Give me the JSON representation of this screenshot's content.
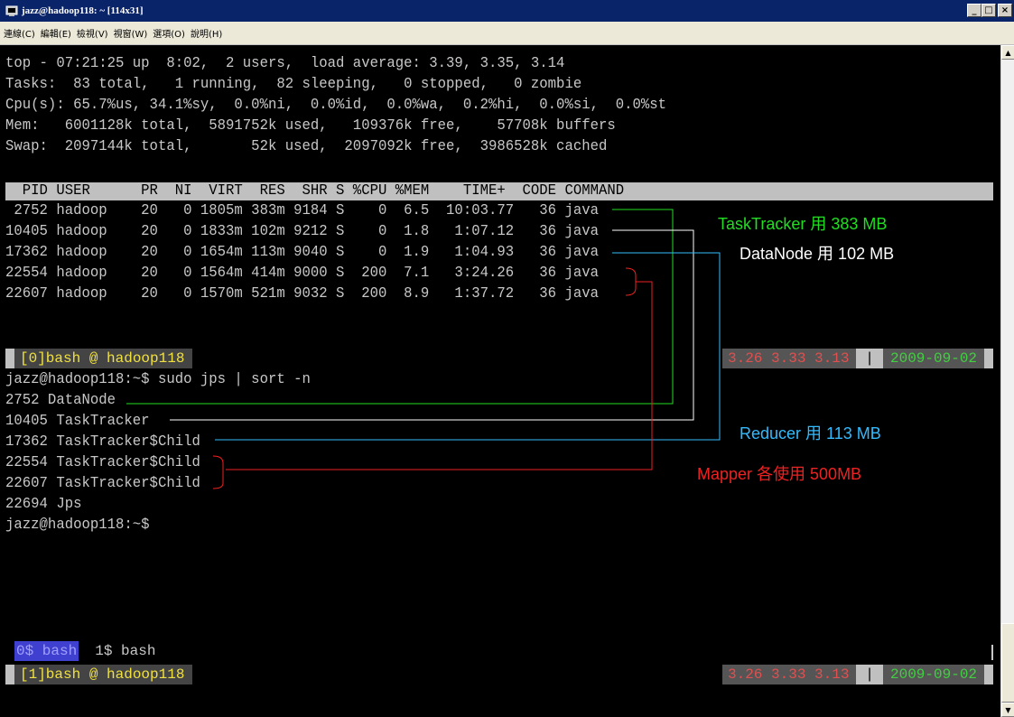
{
  "window": {
    "title": "jazz@hadoop118: ~ [114x31]",
    "buttons": {
      "minimize": "_",
      "maximize": "□",
      "close": "×"
    }
  },
  "menu": [
    "連線(C)",
    "編輯(E)",
    "檢視(V)",
    "視窗(W)",
    "選項(O)",
    "說明(H)"
  ],
  "top": {
    "summary": [
      "top - 07:21:25 up  8:02,  2 users,  load average: 3.39, 3.35, 3.14",
      "Tasks:  83 total,   1 running,  82 sleeping,   0 stopped,   0 zombie",
      "Cpu(s): 65.7%us, 34.1%sy,  0.0%ni,  0.0%id,  0.0%wa,  0.2%hi,  0.0%si,  0.0%st",
      "Mem:   6001128k total,  5891752k used,   109376k free,    57708k buffers",
      "Swap:  2097144k total,       52k used,  2097092k free,  3986528k cached"
    ],
    "header": "  PID USER      PR  NI  VIRT  RES  SHR S %CPU %MEM    TIME+  CODE COMMAND",
    "processes": [
      " 2752 hadoop    20   0 1805m 383m 9184 S    0  6.5  10:03.77   36 java",
      "10405 hadoop    20   0 1833m 102m 9212 S    0  1.8   1:07.12   36 java",
      "17362 hadoop    20   0 1654m 113m 9040 S    0  1.9   1:04.93   36 java",
      "22554 hadoop    20   0 1564m 414m 9000 S  200  7.1   3:24.26   36 java",
      "22607 hadoop    20   0 1570m 521m 9032 S  200  8.9   1:37.72   36 java"
    ]
  },
  "status_bar_0": {
    "window": "[0]bash @ hadoop118",
    "load": "3.26 3.33 3.13",
    "sep": "|",
    "date": "2009-09-02"
  },
  "shell": [
    "jazz@hadoop118:~$ sudo jps | sort -n",
    "2752 DataNode",
    "10405 TaskTracker",
    "17362 TaskTracker$Child",
    "22554 TaskTracker$Child",
    "22607 TaskTracker$Child",
    "22694 Jps",
    "jazz@hadoop118:~$"
  ],
  "status_bar_1": {
    "window": "[1]bash @ hadoop118",
    "load": "3.26 3.33 3.13",
    "sep": "|",
    "date": "2009-09-02"
  },
  "tabs": {
    "active": "0$ bash",
    "other": "1$ bash"
  },
  "annotations": {
    "tasktracker": {
      "text": "TaskTracker 用 383 MB",
      "color": "#22dd22"
    },
    "datanode": {
      "text": "DataNode 用 102 MB",
      "color": "#ffffff"
    },
    "reducer": {
      "text": "Reducer 用 113 MB",
      "color": "#33bbff"
    },
    "mapper": {
      "text": "Mapper  各使用   500MB",
      "color": "#ee2222"
    }
  }
}
